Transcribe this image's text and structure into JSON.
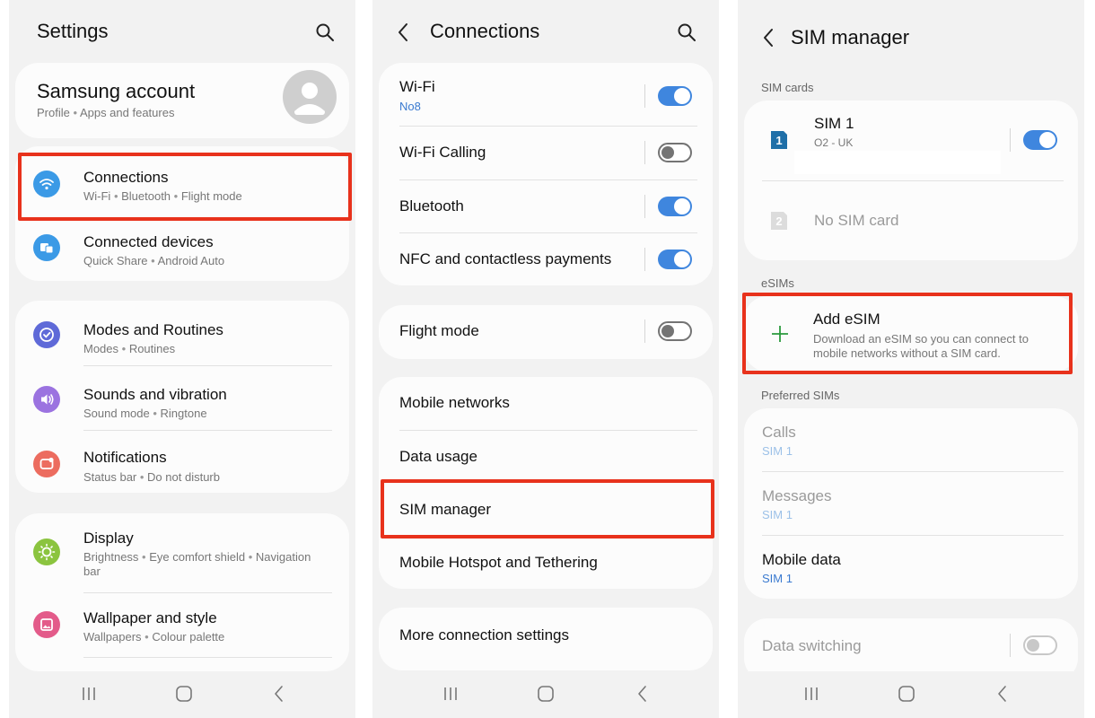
{
  "colors": {
    "highlight": "#e8321c",
    "toggle_on": "#3f86de",
    "link_blue": "#3a7ad0",
    "background": "#f2f2f2",
    "card": "#fcfcfc"
  },
  "settings": {
    "title": "Settings",
    "account": {
      "title": "Samsung account",
      "sub1": "Profile",
      "sub2": "Apps and features"
    },
    "items": [
      {
        "label": "Connections",
        "sub": [
          "Wi-Fi",
          "Bluetooth",
          "Flight mode"
        ],
        "icon": "wifi-icon"
      },
      {
        "label": "Connected devices",
        "sub": [
          "Quick Share",
          "Android Auto"
        ],
        "icon": "connected-devices-icon"
      },
      {
        "label": "Modes and Routines",
        "sub": [
          "Modes",
          "Routines"
        ],
        "icon": "modes-icon"
      },
      {
        "label": "Sounds and vibration",
        "sub": [
          "Sound mode",
          "Ringtone"
        ],
        "icon": "volume-icon"
      },
      {
        "label": "Notifications",
        "sub": [
          "Status bar",
          "Do not disturb"
        ],
        "icon": "notifications-icon"
      },
      {
        "label": "Display",
        "sub": [
          "Brightness",
          "Eye comfort shield",
          "Navigation"
        ],
        "sub2": "bar",
        "icon": "brightness-icon"
      },
      {
        "label": "Wallpaper and style",
        "sub": [
          "Wallpapers",
          "Colour palette"
        ],
        "icon": "wallpaper-icon"
      }
    ]
  },
  "connections": {
    "title": "Connections",
    "wifi": {
      "label": "Wi-Fi",
      "network": "No8",
      "enabled": true
    },
    "wifi_calling": {
      "label": "Wi-Fi Calling",
      "enabled": false
    },
    "bluetooth": {
      "label": "Bluetooth",
      "enabled": true
    },
    "nfc": {
      "label": "NFC and contactless payments",
      "enabled": true
    },
    "flight_mode": {
      "label": "Flight mode",
      "enabled": false
    },
    "mobile_networks": "Mobile networks",
    "data_usage": "Data usage",
    "sim_manager": "SIM manager",
    "hotspot": "Mobile Hotspot and Tethering",
    "more": "More connection settings"
  },
  "sim_manager": {
    "title": "SIM manager",
    "sim_cards_label": "SIM cards",
    "sim1": {
      "label": "SIM 1",
      "carrier": "O2 - UK",
      "badge": "1",
      "enabled": true
    },
    "sim2": {
      "label": "No SIM card",
      "badge": "2"
    },
    "esims_label": "eSIMs",
    "add_esim": {
      "label": "Add eSIM",
      "desc1": "Download an eSIM so you can connect to",
      "desc2": "mobile networks without a SIM card."
    },
    "preferred_label": "Preferred SIMs",
    "calls": {
      "label": "Calls",
      "value": "SIM 1"
    },
    "messages": {
      "label": "Messages",
      "value": "SIM 1"
    },
    "mobile_data": {
      "label": "Mobile data",
      "value": "SIM 1"
    },
    "data_switching": {
      "label": "Data switching",
      "enabled": false
    }
  }
}
